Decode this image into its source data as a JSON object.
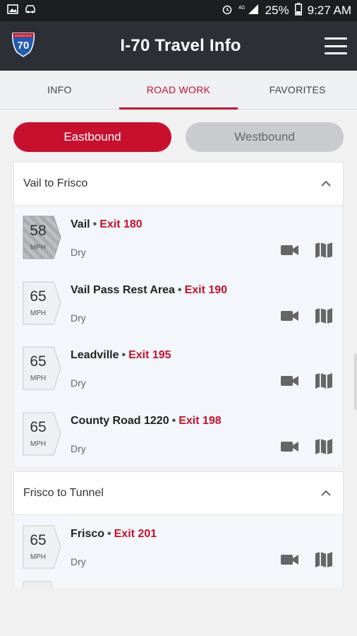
{
  "status_bar": {
    "battery": "25%",
    "time": "9:27 AM",
    "network": "4G LTE"
  },
  "app": {
    "title": "I-70 Travel Info",
    "shield_number": "70",
    "shield_top": "INTERSTATE"
  },
  "tabs": [
    {
      "label": "INFO"
    },
    {
      "label": "ROAD WORK"
    },
    {
      "label": "FAVORITES"
    }
  ],
  "active_tab": "ROAD WORK",
  "directions": {
    "eastbound": "Eastbound",
    "westbound": "Westbound",
    "selected": "Eastbound"
  },
  "sections": [
    {
      "title": "Vail to Frisco",
      "rows": [
        {
          "speed": "58",
          "unit": "MPH",
          "place": "Vail",
          "exit": "Exit 180",
          "condition": "Dry",
          "speed_style": "reduced"
        },
        {
          "speed": "65",
          "unit": "MPH",
          "place": "Vail Pass Rest Area",
          "exit": "Exit 190",
          "condition": "Dry",
          "speed_style": "normal"
        },
        {
          "speed": "65",
          "unit": "MPH",
          "place": "Leadville",
          "exit": "Exit 195",
          "condition": "Dry",
          "speed_style": "normal"
        },
        {
          "speed": "65",
          "unit": "MPH",
          "place": "County Road 1220",
          "exit": "Exit 198",
          "condition": "Dry",
          "speed_style": "normal"
        }
      ]
    },
    {
      "title": "Frisco to Tunnel",
      "rows": [
        {
          "speed": "65",
          "unit": "MPH",
          "place": "Frisco",
          "exit": "Exit 201",
          "condition": "Dry",
          "speed_style": "normal"
        }
      ]
    }
  ],
  "separator": "•",
  "colors": {
    "accent": "#c8102e",
    "appbar": "#2c3036",
    "statusbar": "#1d1e20"
  },
  "icons": {
    "camera": "video-camera-icon",
    "map": "map-icon",
    "collapse": "chevron-up-icon",
    "menu": "hamburger-menu-icon"
  }
}
